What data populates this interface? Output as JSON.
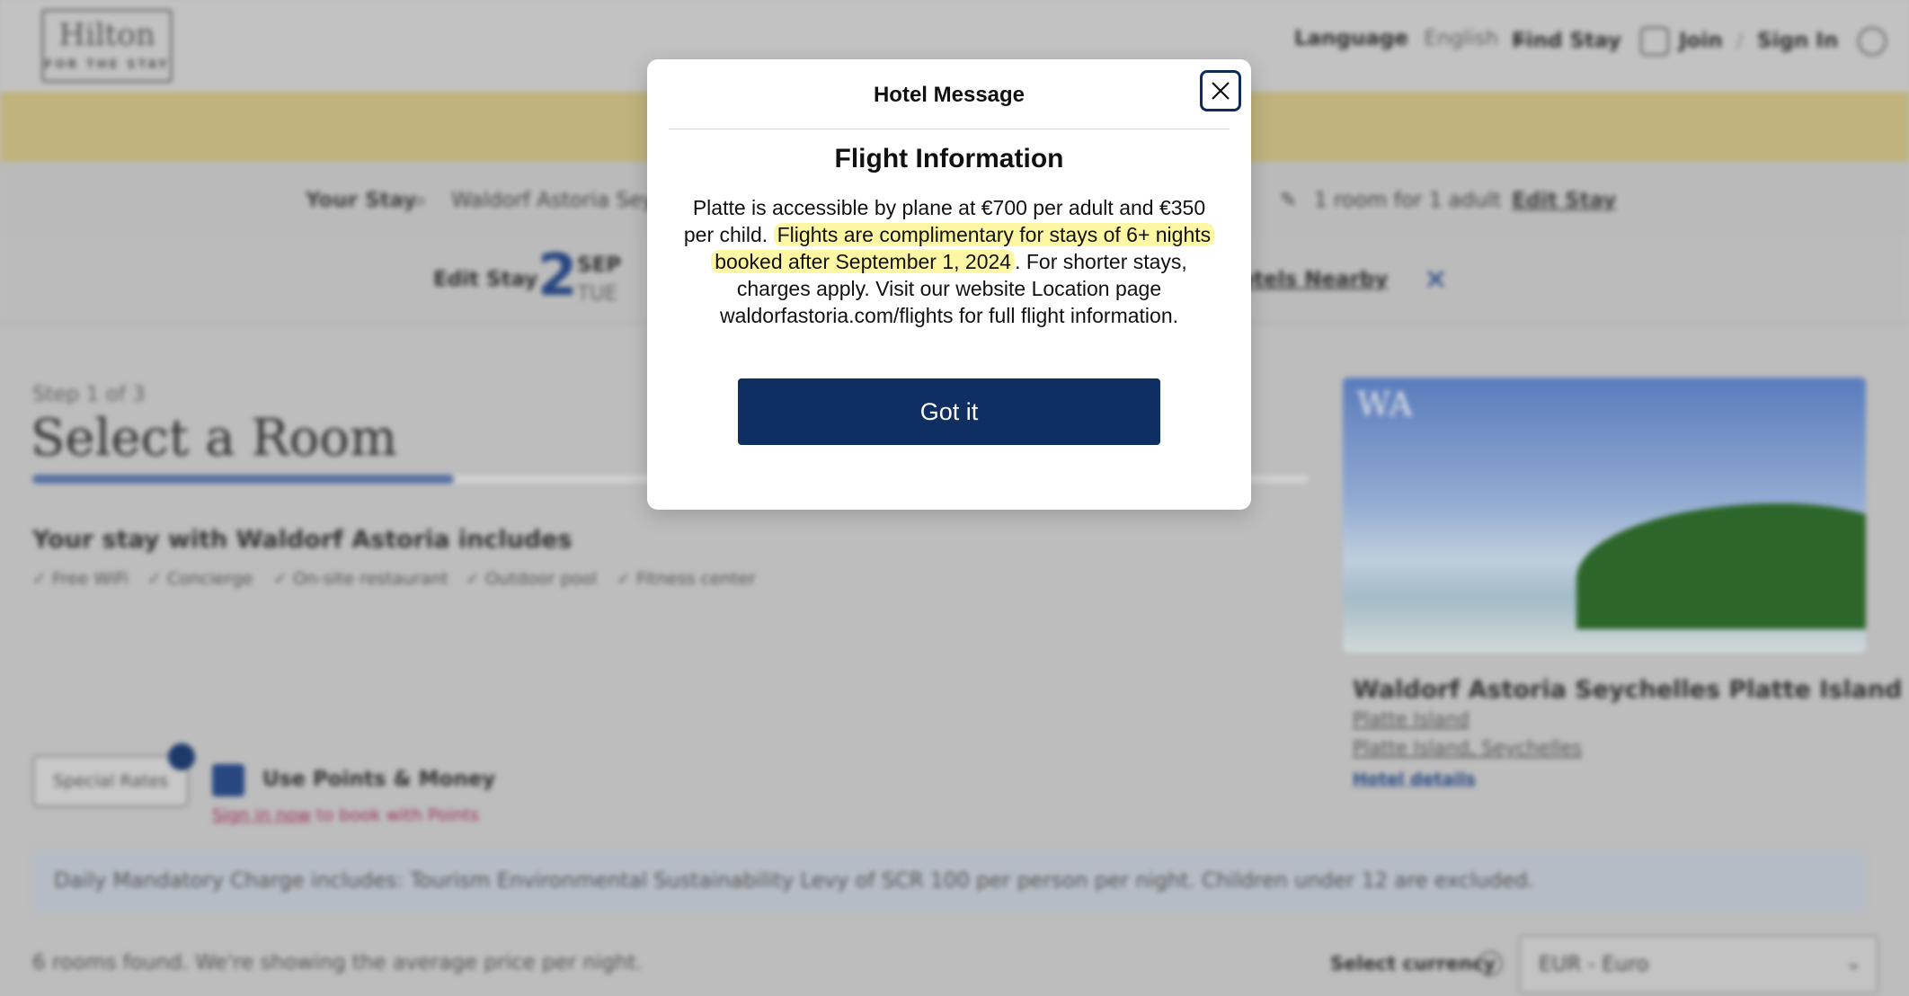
{
  "header": {
    "logo_name": "Hilton",
    "logo_tag": "FOR THE STAY",
    "language_label": "Language",
    "language_value": "English",
    "find_stay": "Find Stay",
    "join": "Join",
    "sign_in": "Sign In"
  },
  "stay_bar": {
    "label": "Your Stay",
    "hotel": "Waldorf Astoria Seych",
    "rooms": "1 room for 1 adult",
    "edit": "Edit Stay"
  },
  "edit_bar": {
    "label": "Edit Stay",
    "day": "2",
    "month": "SEP",
    "weekday": "TUE",
    "nearby": "Hotels Nearby"
  },
  "main": {
    "step": "Step 1 of 3",
    "title": "Select a Room",
    "progress_fraction": 0.33,
    "includes_title": "Your stay with Waldorf Astoria includes",
    "amenities": [
      "✓ Free WiFi",
      "✓ Concierge",
      "✓ On-site restaurant",
      "✓ Outdoor pool",
      "✓ Fitness center"
    ],
    "special_rates": "Special Rates",
    "use_points": "Use Points & Money",
    "sign_in_link": "Sign in now",
    "sign_in_suffix": " to book with Points",
    "notice": "Daily Mandatory Charge includes: Tourism Environmental Sustainability Levy of SCR 100 per person per night. Children under 12 are excluded.",
    "rooms_found": "6 rooms found. We're showing the average price per night.",
    "currency_label": "Select currency",
    "currency_value": "EUR - Euro"
  },
  "hotel_card": {
    "image_mark": "WA",
    "name": "Waldorf Astoria Seychelles Platte Island",
    "line1": "Platte Island",
    "line2": "Platte Island, Seychelles",
    "details_link": "Hotel details"
  },
  "modal": {
    "header": "Hotel Message",
    "title": "Flight Information",
    "body_pre": "Platte is accessible by plane at €700 per adult and €350 per child. ",
    "body_highlight": "Flights are complimentary for stays of 6+ nights booked after September 1, 2024",
    "body_post": ". For shorter stays, charges apply. Visit our website Location page waldorfastoria.com/flights for full flight information.",
    "button": "Got it",
    "highlight_color": "#fdf6a3",
    "button_color": "#0f2f62"
  }
}
